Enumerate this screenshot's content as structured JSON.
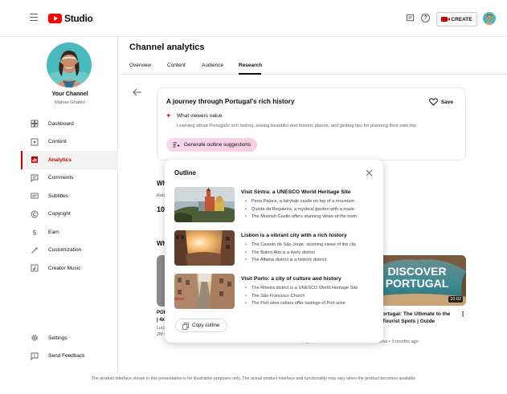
{
  "app": {
    "logo_text": "Studio",
    "create_label": "CREATE"
  },
  "sidebar": {
    "channel_name": "Your Channel",
    "channel_handle": "Mahsa Ghaferi",
    "items": [
      {
        "label": "Dashboard",
        "icon": "dashboard-icon"
      },
      {
        "label": "Content",
        "icon": "content-icon"
      },
      {
        "label": "Analytics",
        "icon": "analytics-icon",
        "active": true
      },
      {
        "label": "Comments",
        "icon": "comments-icon"
      },
      {
        "label": "Subtitles",
        "icon": "subtitles-icon"
      },
      {
        "label": "Copyright",
        "icon": "copyright-icon"
      },
      {
        "label": "Earn",
        "icon": "dollar-icon"
      },
      {
        "label": "Customization",
        "icon": "magic-wand-icon"
      },
      {
        "label": "Creator Music",
        "icon": "music-icon"
      }
    ],
    "bottom_items": [
      {
        "label": "Settings",
        "icon": "gear-icon"
      },
      {
        "label": "Send Feedback",
        "icon": "feedback-icon"
      }
    ]
  },
  "main": {
    "title": "Channel analytics",
    "tabs": [
      "Overview",
      "Content",
      "Audience",
      "Research"
    ],
    "active_tab": "Research"
  },
  "topic": {
    "title": "A journey through Portugal's rich history",
    "save_label": "Save",
    "what_viewers_value": "What viewers value",
    "description": "Learning about Portugal's rich history, seeing beautiful and historic places, and getting tips for planning their own trip.",
    "generate_label": "Generate outline suggestions"
  },
  "background": {
    "wh1": "Wh",
    "rela": "Rela",
    "num": "10(",
    "wh2": "Wh",
    "left_title_1": "POR",
    "left_title_2": "| 4x",
    "left_meta_1": "Luca",
    "left_meta_2": "2M v",
    "thumb_text_1": "DISCOVER",
    "thumb_text_2": "PORTUGAL",
    "duration": "10:02",
    "right_title": "ver Portugal: The Ultimate to the Best Tourist Spots | Guide",
    "right_meta": "340 views • 3 months ago",
    "mid_meta": "374 views • 3 months ago"
  },
  "outline": {
    "title": "Outline",
    "items": [
      {
        "heading": "Visit Sintra: a UNESCO World Heritage Site",
        "bullets": [
          "Pena Palace, a fairytale castle on top of a mountain",
          "Quinta da Regaleira, a mystical garden with a maze",
          "The Moorish Castle offers stunning views of the town"
        ]
      },
      {
        "heading": "Lisbon is a vibrant city with a rich history",
        "bullets": [
          "The Castelo de São Jorge, stunning views of the city",
          "The Bairro Alto is a lively district",
          "The Alfama district is a historic district"
        ]
      },
      {
        "heading": "Visit Porto: a city of culture and history",
        "bullets": [
          "The Ribeira district is a UNESCO World Heritage Site",
          "The São Francisco Church",
          "The Port wine cellars offer tastings of Port wine"
        ]
      }
    ],
    "copy_label": "Copy outline"
  },
  "footer": "The product interface shown in this presentation is for illustrative purposes only. The actual product interface and functionality may vary when the product becomes available"
}
